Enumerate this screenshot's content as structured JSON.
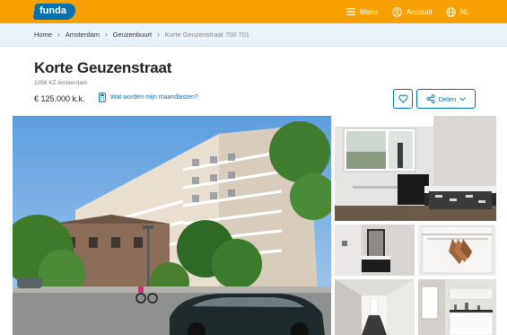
{
  "header": {
    "logo_text": "funda",
    "menu_label": "Menu",
    "account_label": "Account",
    "language_label": "NL"
  },
  "breadcrumb": {
    "items": [
      "Home",
      "Amsterdam",
      "Geuzenbuurt",
      "Korte Geuzenstraat 700 701"
    ]
  },
  "listing": {
    "title": "Korte Geuzenstraat",
    "address": "1056 KZ Amsterdam",
    "price": "€ 125.000 k.k.",
    "monthly_costs_link": "Wat worden mijn maandlasten?",
    "share_label": "Delen"
  },
  "colors": {
    "brand_orange": "#f7a100",
    "brand_blue": "#0071b3",
    "breadcrumb_bg": "#e9f2f9"
  },
  "icons": {
    "menu": "hamburger-icon",
    "account": "user-circle-icon",
    "language": "globe-icon",
    "costs": "calculator-icon",
    "favorite": "heart-icon",
    "share": "share-icon"
  }
}
